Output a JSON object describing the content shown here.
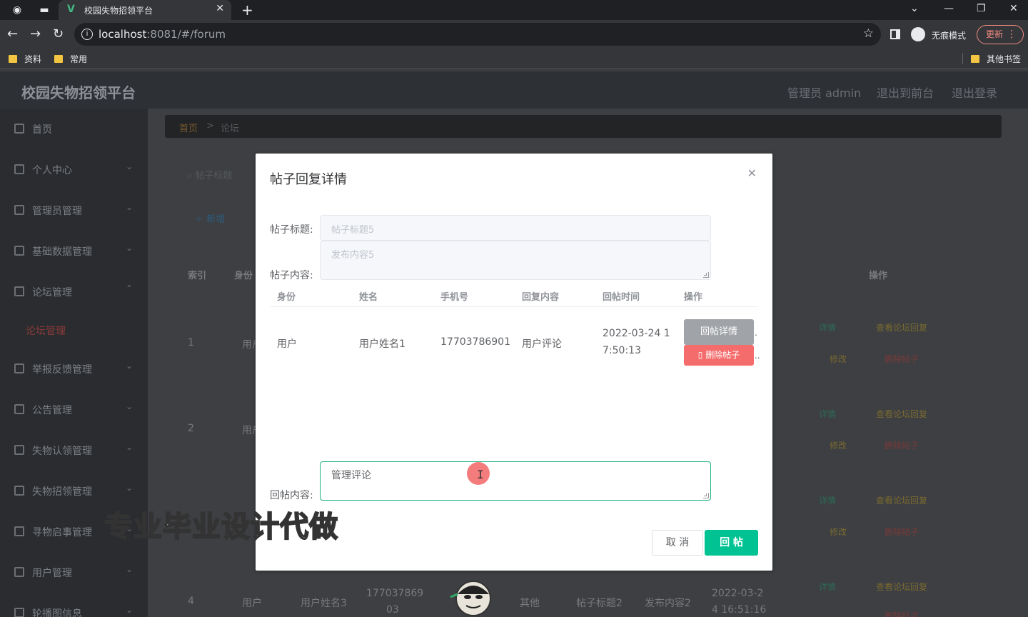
{
  "browser": {
    "tab_title": "校园失物招领平台",
    "url_host": "localhost",
    "url_rest": ":8081/#/forum",
    "incognito_label": "无痕模式",
    "update_label": "更新",
    "bookmarks": [
      "资料",
      "常用"
    ],
    "other_bookmarks": "其他书签"
  },
  "app": {
    "title": "校园失物招领平台",
    "header_links": [
      "管理员 admin",
      "退出到前台",
      "退出登录"
    ]
  },
  "sidebar": {
    "items": [
      "首页",
      "个人中心",
      "管理员管理",
      "基础数据管理",
      "论坛管理",
      "举报反馈管理",
      "公告管理",
      "失物认领管理",
      "失物招领管理",
      "寻物启事管理",
      "用户管理",
      "轮播图信息"
    ],
    "active_sub": "论坛管理"
  },
  "breadcrumb": {
    "home": "首页",
    "current": "论坛"
  },
  "list": {
    "search_placeholder": "帖子标题",
    "add_label": "新增",
    "columns": [
      "索引",
      "身份"
    ],
    "op_header": "操作",
    "rows": [
      {
        "index": "1",
        "identity": "用户"
      },
      {
        "index": "2",
        "identity": "用户"
      },
      {
        "index": "4",
        "identity": "用户",
        "name": "用户姓名3",
        "phone_a": "177037869",
        "phone_b": "03",
        "type": "其他",
        "title": "帖子标题2",
        "content": "发布内容2",
        "time_a": "2022-03-2",
        "time_b": "4 16:51:16"
      }
    ],
    "actions": {
      "detail": "详情",
      "view_reply": "查看论坛回复",
      "edit": "修改",
      "delete": "删除帖子"
    }
  },
  "modal": {
    "title": "帖子回复详情",
    "post_title_label": "帖子标题:",
    "post_title_value": "帖子标题5",
    "post_content_label": "帖子内容:",
    "post_content_value": "发布内容5",
    "table_headers": [
      "身份",
      "姓名",
      "手机号",
      "回复内容",
      "回帖时间",
      "操作"
    ],
    "row": {
      "identity": "用户",
      "name": "用户姓名1",
      "phone": "17703786901",
      "reply": "用户评论",
      "time_a": "2022-03-24 1",
      "time_b": "7:50:13",
      "detail_button": "回帖详情",
      "delete_button": "删除帖子"
    },
    "reply_label": "回帖内容:",
    "reply_value": "管理评论",
    "cancel_label": "取 消",
    "submit_label": "回 帖"
  },
  "watermark": "专业毕业设计代做"
}
